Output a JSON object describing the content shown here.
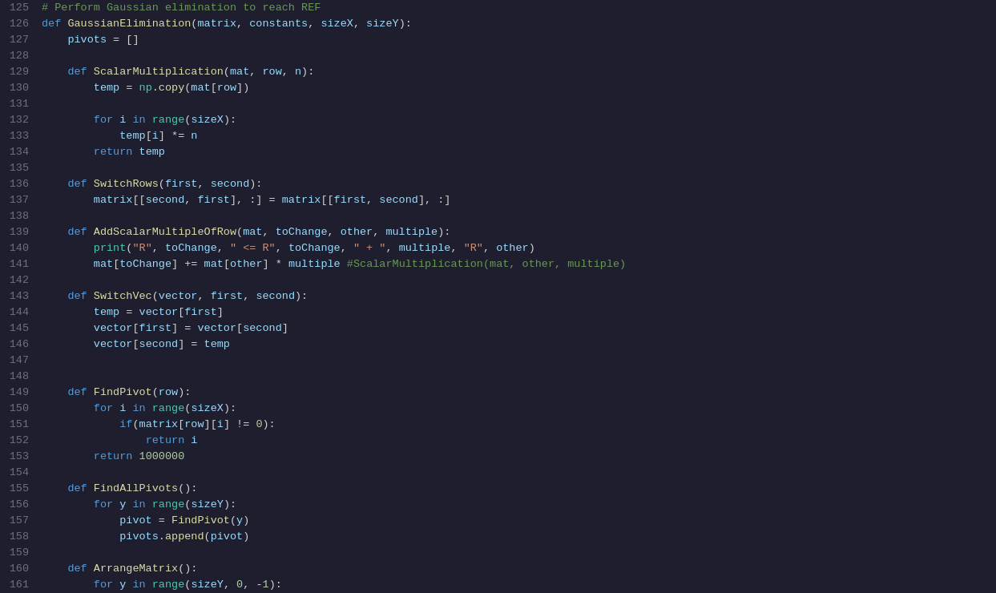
{
  "editor": {
    "background": "#1e1e2e",
    "lines": [
      {
        "num": "125",
        "content": "comment_perform_gaussian"
      },
      {
        "num": "126",
        "content": "def_gaussian_elimination"
      },
      {
        "num": "127",
        "content": "pivots_assign"
      },
      {
        "num": "128",
        "content": "blank"
      },
      {
        "num": "129",
        "content": "def_scalar_mult"
      },
      {
        "num": "130",
        "content": "temp_assign"
      },
      {
        "num": "131",
        "content": "blank"
      },
      {
        "num": "132",
        "content": "for_i_range"
      },
      {
        "num": "133",
        "content": "temp_i_multiply"
      },
      {
        "num": "134",
        "content": "return_temp"
      },
      {
        "num": "135",
        "content": "blank"
      },
      {
        "num": "136",
        "content": "def_switch_rows"
      },
      {
        "num": "137",
        "content": "matrix_assign"
      },
      {
        "num": "138",
        "content": "blank"
      },
      {
        "num": "139",
        "content": "def_add_scalar"
      },
      {
        "num": "140",
        "content": "print_statement"
      },
      {
        "num": "141",
        "content": "mat_tochange"
      },
      {
        "num": "142",
        "content": "blank"
      },
      {
        "num": "143",
        "content": "def_switch_vec"
      },
      {
        "num": "144",
        "content": "temp_vector_first"
      },
      {
        "num": "145",
        "content": "vector_first_assign"
      },
      {
        "num": "146",
        "content": "vector_second_assign"
      },
      {
        "num": "147",
        "content": "blank"
      },
      {
        "num": "148",
        "content": "blank"
      },
      {
        "num": "149",
        "content": "def_find_pivot"
      },
      {
        "num": "150",
        "content": "for_i_range_sizex"
      },
      {
        "num": "151",
        "content": "if_matrix_row"
      },
      {
        "num": "152",
        "content": "return_i"
      },
      {
        "num": "153",
        "content": "return_1000000"
      },
      {
        "num": "154",
        "content": "blank"
      },
      {
        "num": "155",
        "content": "def_find_all_pivots"
      },
      {
        "num": "156",
        "content": "for_y_range"
      },
      {
        "num": "157",
        "content": "pivot_assign"
      },
      {
        "num": "158",
        "content": "pivots_append"
      },
      {
        "num": "159",
        "content": "blank"
      },
      {
        "num": "160",
        "content": "def_arrange_matrix"
      },
      {
        "num": "161",
        "content": "for_y_range_sizey"
      }
    ]
  }
}
